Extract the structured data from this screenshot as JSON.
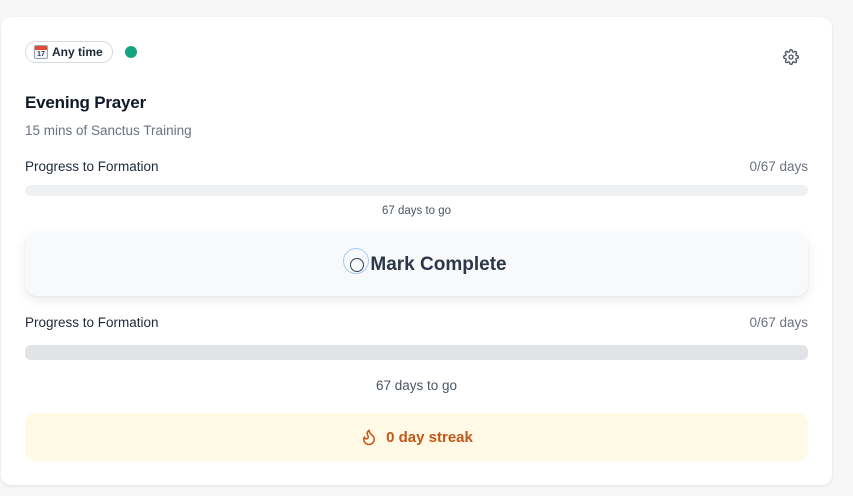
{
  "habit": {
    "time_badge": {
      "icon": "calendar-icon",
      "calendar_day": "17",
      "label": "Any time"
    },
    "status_color": "#16a37f",
    "settings_icon": "gear-icon",
    "title": "Evening Prayer",
    "subtitle": "15 mins of Sanctus Training"
  },
  "progress_top": {
    "label": "Progress to Formation",
    "count": "0/67 days",
    "fraction": 0,
    "remaining": "67 days to go"
  },
  "mark_complete": {
    "icon": "circle-icon",
    "label": "Mark Complete"
  },
  "progress_bottom": {
    "label": "Progress to Formation",
    "count": "0/67 days",
    "fraction": 0,
    "remaining": "67 days to go"
  },
  "streak": {
    "icon": "flame-icon",
    "label": "0 day streak",
    "color": "#c2571a",
    "background": "#fff9e6"
  }
}
